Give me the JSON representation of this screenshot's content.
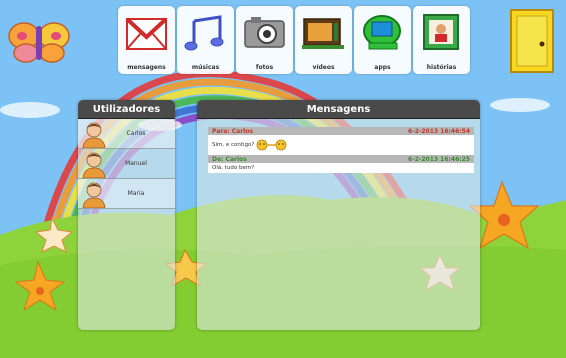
{
  "apps": [
    {
      "label": "mensagens",
      "icon": "mail-icon"
    },
    {
      "label": "músicas",
      "icon": "music-note-icon"
    },
    {
      "label": "fotos",
      "icon": "camera-icon"
    },
    {
      "label": "vídeos",
      "icon": "video-tv-icon"
    },
    {
      "label": "apps",
      "icon": "apps-computer-icon"
    },
    {
      "label": "histórias",
      "icon": "storybook-icon"
    }
  ],
  "users_panel": {
    "title": "Utilizadores",
    "users": [
      {
        "name": "Carlos",
        "icon": "avatar-icon"
      },
      {
        "name": "Manuel",
        "icon": "avatar-icon"
      },
      {
        "name": "Maria",
        "icon": "avatar-icon"
      }
    ]
  },
  "messages_panel": {
    "title": "Mensagens",
    "messages": [
      {
        "header": "Para: Carlos",
        "timestamp": "6-2-2013 16:46:54",
        "body": "Sim, e contigo?",
        "direction": "to"
      },
      {
        "header": "De: Carlos",
        "timestamp": "6-2-2013 16:46:25",
        "body": "Olá, tudo bem?",
        "direction": "from"
      }
    ]
  },
  "colors": {
    "header_to": "#c0392b",
    "header_from": "#3a8a2e",
    "panel_header": "#4a4a4a"
  }
}
